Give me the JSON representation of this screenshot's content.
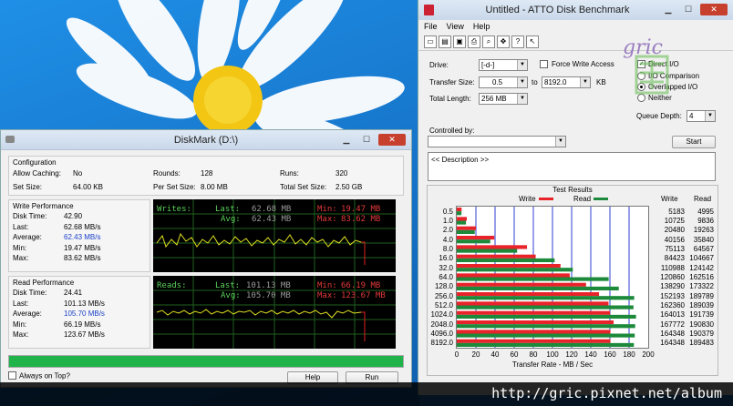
{
  "diskmark": {
    "title": "DiskMark (D:\\)",
    "configuration": {
      "title": "Configuration",
      "allow_caching_label": "Allow Caching:",
      "allow_caching_value": "No",
      "rounds_label": "Rounds:",
      "rounds_value": "128",
      "runs_label": "Runs:",
      "runs_value": "320",
      "set_size_label": "Set Size:",
      "set_size_value": "64.00 KB",
      "per_set_size_label": "Per Set Size:",
      "per_set_size_value": "8.00 MB",
      "total_set_size_label": "Total Set Size:",
      "total_set_size_value": "2.50 GB"
    },
    "write": {
      "title": "Write Performance",
      "rows": [
        {
          "label": "Disk Time:",
          "value": "42.90"
        },
        {
          "label": "Last:",
          "value": "62.68 MB/s"
        },
        {
          "label": "Average:",
          "value": "62.43 MB/s"
        },
        {
          "label": "Min:",
          "value": "19.47 MB/s"
        },
        {
          "label": "Max:",
          "value": "83.62 MB/s"
        }
      ],
      "graph": {
        "name": "Writes:",
        "last_label": "Last:",
        "last": "62.68 MB",
        "avg_label": "Avg:",
        "avg": "62.43 MB",
        "min_label": "Min:",
        "min": "19.47 MB",
        "max_label": "Max:",
        "max": "83.62 MB"
      }
    },
    "read": {
      "title": "Read Performance",
      "rows": [
        {
          "label": "Disk Time:",
          "value": "24.41"
        },
        {
          "label": "Last:",
          "value": "101.13 MB/s"
        },
        {
          "label": "Average:",
          "value": "105.70 MB/s"
        },
        {
          "label": "Min:",
          "value": "66.19 MB/s"
        },
        {
          "label": "Max:",
          "value": "123.67 MB/s"
        }
      ],
      "graph": {
        "name": "Reads:",
        "last_label": "Last:",
        "last": "101.13 MB",
        "avg_label": "Avg:",
        "avg": "105.70 MB",
        "min_label": "Min:",
        "min": "66.19 MB",
        "max_label": "Max:",
        "max": "123.67 MB"
      }
    },
    "progress_fraction": 1.0,
    "always_on_top_label": "Always on Top?",
    "help_label": "Help",
    "run_label": "Run"
  },
  "atto": {
    "title": "Untitled - ATTO Disk Benchmark",
    "menu": [
      "File",
      "View",
      "Help"
    ],
    "toolbar_icons": [
      "new-icon",
      "open-icon",
      "save-icon",
      "print-icon",
      "print-preview-icon",
      "move-icon",
      "about-icon",
      "context-help-icon"
    ],
    "drive_label": "Drive:",
    "drive_value": "[-d-]",
    "force_write_access_label": "Force Write Access",
    "direct_io_label": "Direct I/O",
    "transfer_size_label": "Transfer Size:",
    "transfer_from": "0.5",
    "to_label": "to",
    "transfer_to": "8192.0",
    "kb_label": "KB",
    "io_comparison_label": "I/O Comparison",
    "overlapped_io_label": "Overlapped I/O",
    "neither_label": "Neither",
    "total_length_label": "Total Length:",
    "total_length_value": "256 MB",
    "queue_depth_label": "Queue Depth:",
    "queue_depth_value": "4",
    "controlled_by_label": "Controlled by:",
    "start_label": "Start",
    "description_text": "<< Description >>"
  },
  "chart_data": {
    "type": "bar",
    "title": "Test Results",
    "xlabel": "Transfer Rate - MB / Sec",
    "xlim": [
      0,
      200
    ],
    "xticks": [
      "0",
      "20",
      "40",
      "60",
      "80",
      "100",
      "120",
      "140",
      "160",
      "180",
      "200"
    ],
    "column_headers": {
      "write": "Write",
      "read": "Read"
    },
    "categories": [
      "0.5",
      "1.0",
      "2.0",
      "4.0",
      "8.0",
      "16.0",
      "32.0",
      "64.0",
      "128.0",
      "256.0",
      "512.0",
      "1024.0",
      "2048.0",
      "4096.0",
      "8192.0"
    ],
    "series": [
      {
        "name": "Write",
        "color": "#e8232a",
        "values": [
          5183,
          10725,
          20480,
          40156,
          75113,
          84423,
          110988,
          120860,
          138290,
          152193,
          162360,
          164013,
          167772,
          164348,
          164348
        ]
      },
      {
        "name": "Read",
        "color": "#1c8a3a",
        "values": [
          4995,
          9836,
          19263,
          35840,
          64567,
          104667,
          124142,
          162516,
          173322,
          189789,
          189039,
          191739,
          190830,
          190379,
          189483
        ]
      }
    ]
  },
  "watermark": {
    "text": "gric",
    "url": "http://gric.pixnet.net/album"
  }
}
